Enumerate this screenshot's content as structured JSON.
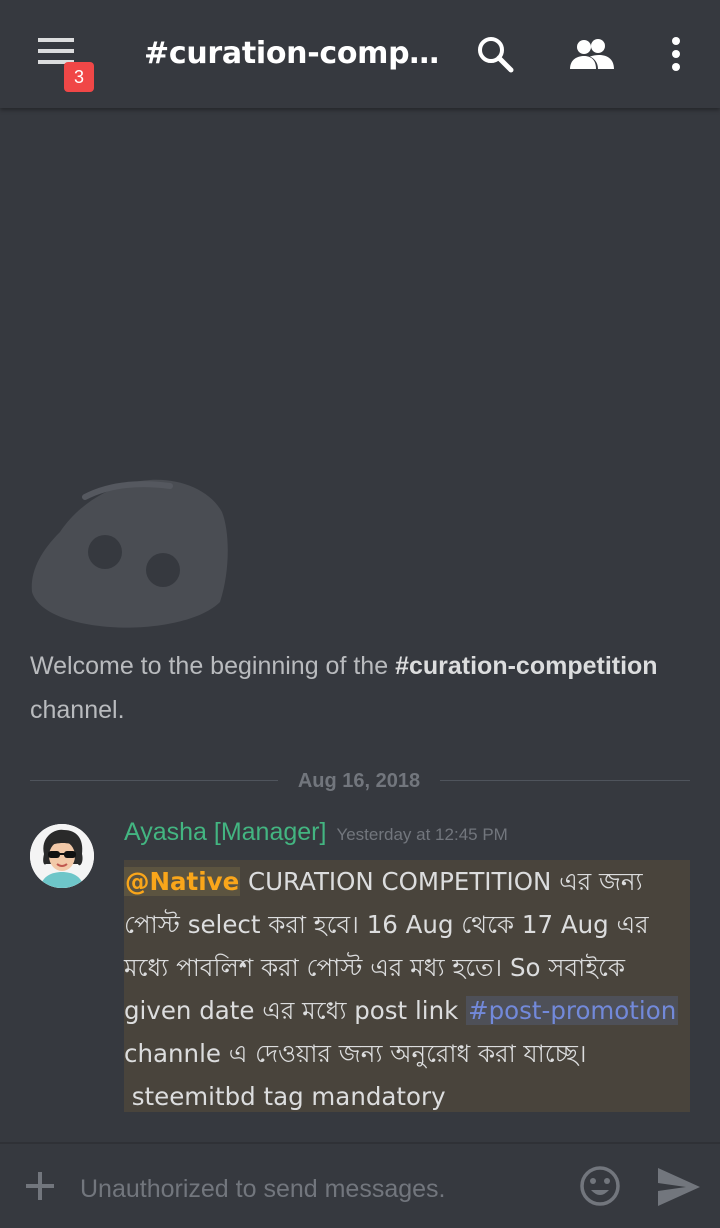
{
  "header": {
    "channel_title": "#curation-compe...",
    "notification_count": "3",
    "icons": [
      "menu-icon",
      "search-icon",
      "members-icon",
      "more-vertical-icon"
    ]
  },
  "welcome": {
    "prefix": "Welcome to the beginning of the ",
    "channel": "#curation-competition",
    "suffix": " channel."
  },
  "divider": {
    "date": "Aug 16, 2018"
  },
  "message": {
    "author": "Ayasha [Manager]",
    "timestamp": "Yesterday at 12:45 PM",
    "mention": "@Native",
    "line1_rest": " CURATION COMPETITION এর জন্য",
    "line2": "পোস্ট select করা হবে। 16 Aug থেকে 17 Aug এর",
    "line3": "মধ্যে পাবলিশ করা পোস্ট এর মধ্য হতে। So সবাইকে",
    "line4_prefix": "given date এর মধ্যে post link ",
    "channel_link": "#post-promotion",
    "line5": "channle এ দেওয়ার জন্য অনুরোধ করা যাচ্ছে।",
    "line6": " steemitbd tag mandatory"
  },
  "composer": {
    "placeholder": "Unauthorized to send messages."
  },
  "colors": {
    "background": "#36393f",
    "author": "#43b581",
    "mention": "#faa61a",
    "channel_link": "#7289da",
    "badge": "#f04747",
    "highlight": "#49443c"
  }
}
